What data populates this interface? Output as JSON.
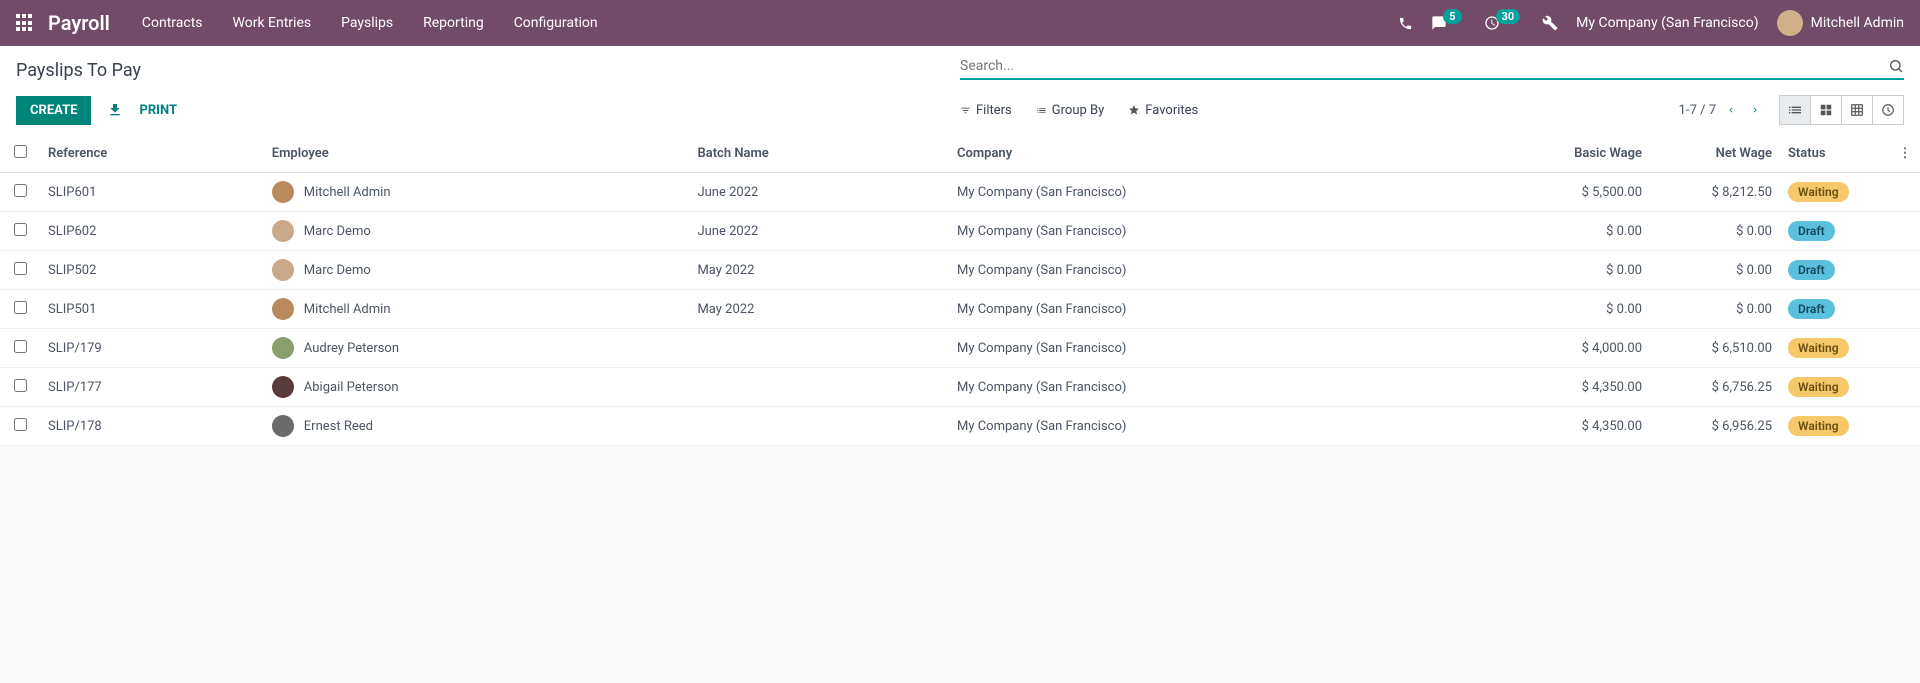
{
  "nav": {
    "brand": "Payroll",
    "menu": [
      "Contracts",
      "Work Entries",
      "Payslips",
      "Reporting",
      "Configuration"
    ],
    "messages_count": "5",
    "activities_count": "30",
    "company": "My Company (San Francisco)",
    "user": "Mitchell Admin"
  },
  "page": {
    "title": "Payslips To Pay",
    "create_label": "CREATE",
    "print_label": "PRINT",
    "search_placeholder": "Search...",
    "filters_label": "Filters",
    "groupby_label": "Group By",
    "favorites_label": "Favorites",
    "pager": "1-7 / 7"
  },
  "columns": {
    "reference": "Reference",
    "employee": "Employee",
    "batch": "Batch Name",
    "company": "Company",
    "basic": "Basic Wage",
    "net": "Net Wage",
    "status": "Status"
  },
  "rows": [
    {
      "reference": "SLIP601",
      "employee": "Mitchell Admin",
      "avatar": "#b98a5e",
      "batch": "June 2022",
      "company": "My Company (San Francisco)",
      "basic": "$ 5,500.00",
      "net": "$ 8,212.50",
      "status": "Waiting",
      "status_class": "status-waiting"
    },
    {
      "reference": "SLIP602",
      "employee": "Marc Demo",
      "avatar": "#c9a98a",
      "batch": "June 2022",
      "company": "My Company (San Francisco)",
      "basic": "$ 0.00",
      "net": "$ 0.00",
      "status": "Draft",
      "status_class": "status-draft"
    },
    {
      "reference": "SLIP502",
      "employee": "Marc Demo",
      "avatar": "#c9a98a",
      "batch": "May 2022",
      "company": "My Company (San Francisco)",
      "basic": "$ 0.00",
      "net": "$ 0.00",
      "status": "Draft",
      "status_class": "status-draft"
    },
    {
      "reference": "SLIP501",
      "employee": "Mitchell Admin",
      "avatar": "#b98a5e",
      "batch": "May 2022",
      "company": "My Company (San Francisco)",
      "basic": "$ 0.00",
      "net": "$ 0.00",
      "status": "Draft",
      "status_class": "status-draft"
    },
    {
      "reference": "SLIP/179",
      "employee": "Audrey Peterson",
      "avatar": "#8a9e6b",
      "batch": "",
      "company": "My Company (San Francisco)",
      "basic": "$ 4,000.00",
      "net": "$ 6,510.00",
      "status": "Waiting",
      "status_class": "status-waiting"
    },
    {
      "reference": "SLIP/177",
      "employee": "Abigail Peterson",
      "avatar": "#5a3b3b",
      "batch": "",
      "company": "My Company (San Francisco)",
      "basic": "$ 4,350.00",
      "net": "$ 6,756.25",
      "status": "Waiting",
      "status_class": "status-waiting"
    },
    {
      "reference": "SLIP/178",
      "employee": "Ernest Reed",
      "avatar": "#6b6b6b",
      "batch": "",
      "company": "My Company (San Francisco)",
      "basic": "$ 4,350.00",
      "net": "$ 6,956.25",
      "status": "Waiting",
      "status_class": "status-waiting"
    }
  ]
}
